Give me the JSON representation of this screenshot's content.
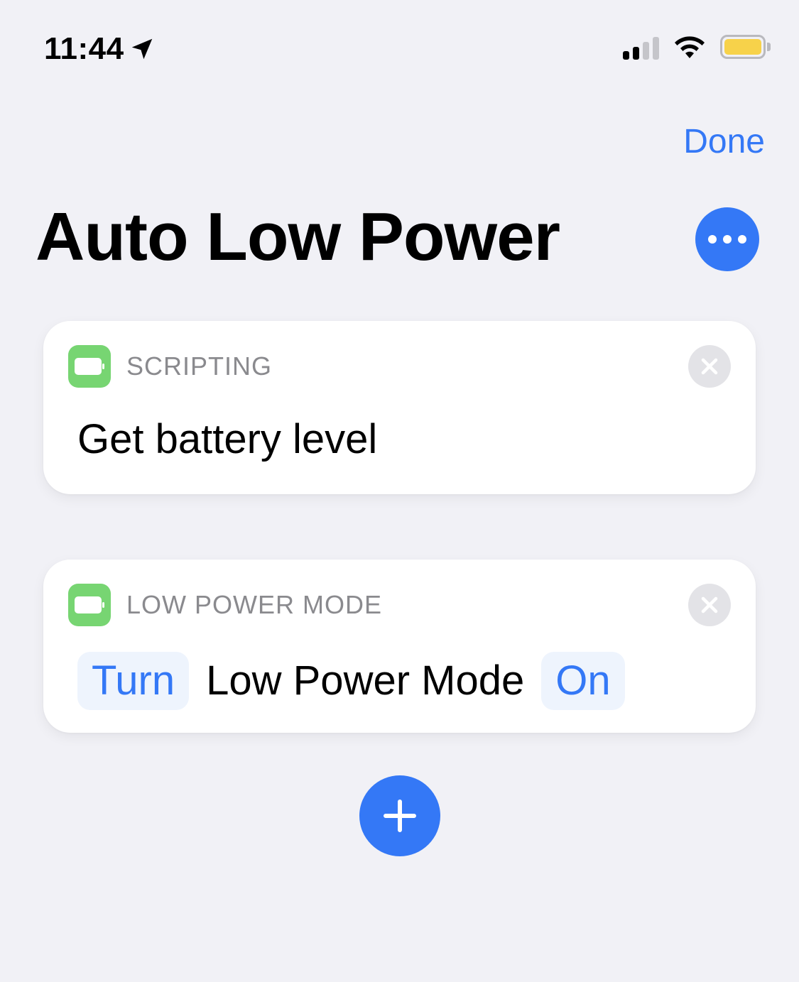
{
  "status_bar": {
    "time": "11:44",
    "location_icon": "location-arrow-icon",
    "signal_icon": "cellular-signal-icon",
    "wifi_icon": "wifi-icon",
    "battery_icon": "battery-icon",
    "battery_color": "#f7d24a"
  },
  "header": {
    "done_label": "Done",
    "title": "Auto Low Power",
    "more_icon": "ellipsis-icon"
  },
  "actions": [
    {
      "category": "SCRIPTING",
      "icon": "battery-icon",
      "text": "Get battery level",
      "remove_icon": "close-icon"
    },
    {
      "category": "LOW POWER MODE",
      "icon": "battery-icon",
      "parts": {
        "param1": "Turn",
        "text": "Low Power Mode",
        "param2": "On"
      },
      "remove_icon": "close-icon"
    }
  ],
  "add_button_icon": "plus-icon",
  "colors": {
    "accent": "#3478f6",
    "background": "#f1f1f6",
    "action_icon": "#77d572"
  }
}
